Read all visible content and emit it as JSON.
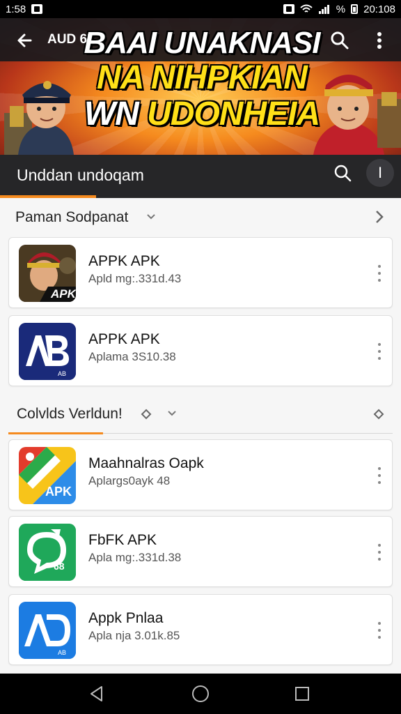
{
  "status_bar": {
    "time_left": "1:58",
    "battery_pct": "%",
    "time_right": "20:108"
  },
  "app_bar": {
    "title": "AUD 6I",
    "back_icon": "arrow-left-icon",
    "search_icon": "search-icon",
    "more_icon": "more-vertical-icon"
  },
  "banner": {
    "line1": "BAAI UNAKNASI",
    "line2": "NA NIHPKIAN",
    "line3_a": "WN",
    "line3_b": "UDONHEIA",
    "colors": {
      "accent": "#f58a1e",
      "headline_yellow": "#ffe018"
    }
  },
  "section": {
    "title": "Unddan undoqam",
    "more_label": "I"
  },
  "group1": {
    "title": "Paman Sodpanat"
  },
  "group2": {
    "title": "Colvlds Verldun!"
  },
  "apps": [
    {
      "name": "APPK APK",
      "sub": "Apld mg:.331d.43",
      "icon": "soldier-apk-icon",
      "badge": "APK"
    },
    {
      "name": "APPK APK",
      "sub": "Aplama 3S10.38",
      "icon": "ab-logo-icon",
      "badge": "AB"
    },
    {
      "name": "Maahnalras Oapk",
      "sub": "Aplargs0ayk 48",
      "icon": "maps-apk-icon",
      "badge": "APK"
    },
    {
      "name": "FbFK APK",
      "sub": "Apla mg:.331d.38",
      "icon": "chat-bubble-icon",
      "badge": "68"
    },
    {
      "name": "Appk Pnlaa",
      "sub": "Apla nja 3.01k.85",
      "icon": "ab-blue-logo-icon",
      "badge": "AB"
    }
  ],
  "nav": {
    "back": "nav-back-icon",
    "home": "nav-home-icon",
    "recent": "nav-recent-icon"
  }
}
